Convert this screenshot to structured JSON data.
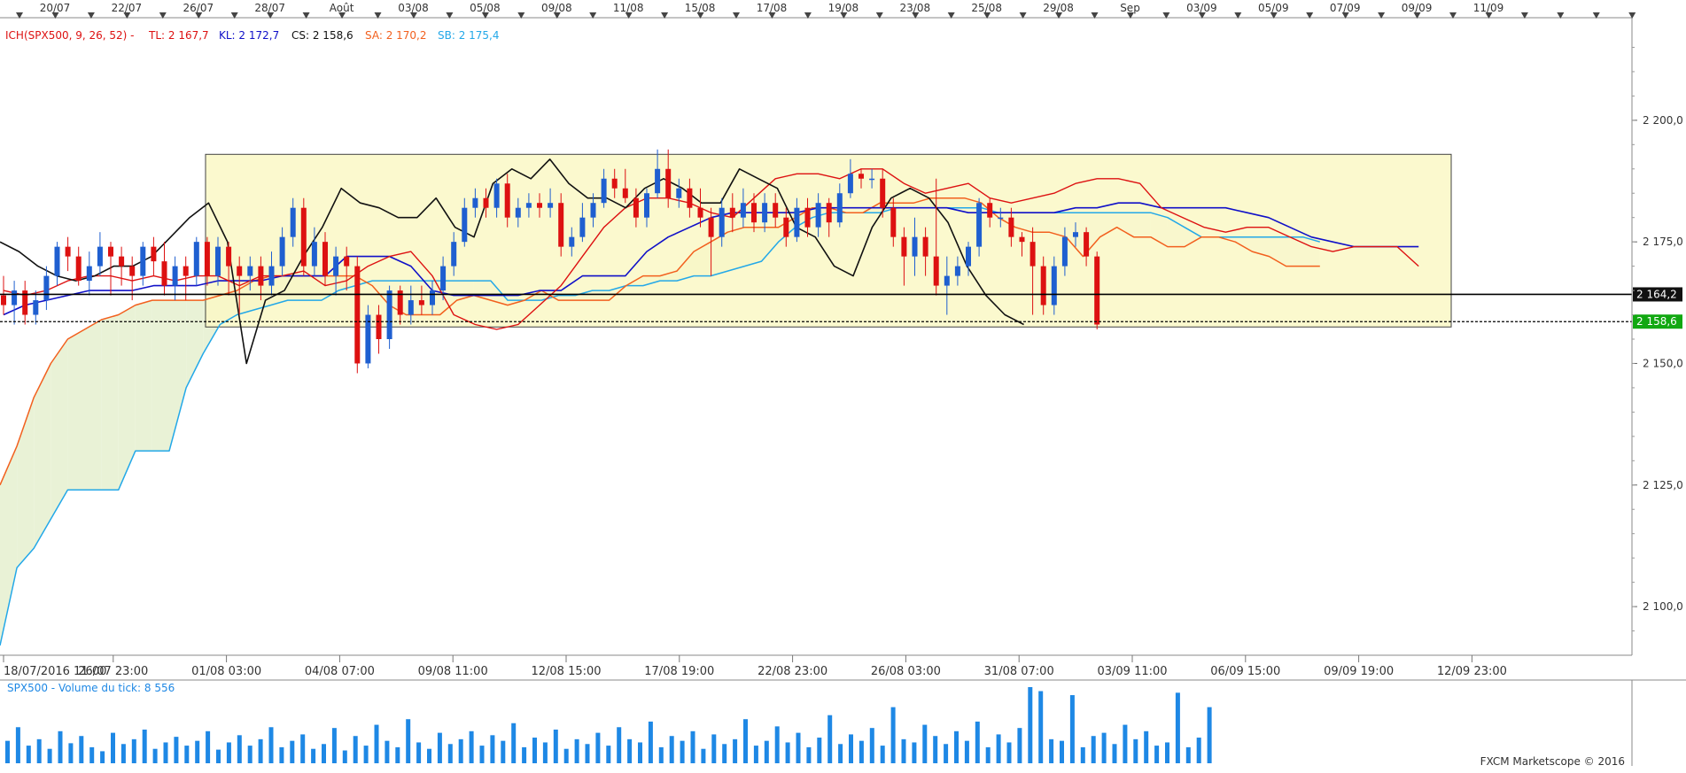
{
  "chart_data": {
    "type": "candlestick",
    "title": "",
    "top_dates": [
      "20/07",
      "22/07",
      "26/07",
      "28/07",
      "Août",
      "03/08",
      "05/08",
      "09/08",
      "11/08",
      "15/08",
      "17/08",
      "19/08",
      "23/08",
      "25/08",
      "29/08",
      "Sep",
      "03/09",
      "05/09",
      "07/09",
      "09/09",
      "11/09"
    ],
    "bottom_dates": [
      "18/07/2016 11:00",
      "26/07 23:00",
      "01/08 03:00",
      "04/08 07:00",
      "09/08 11:00",
      "12/08 15:00",
      "17/08 19:00",
      "22/08 23:00",
      "26/08 03:00",
      "31/08 07:00",
      "03/09 11:00",
      "06/09 15:00",
      "09/09 19:00",
      "12/09 23:00"
    ],
    "ylim": [
      2090,
      2220
    ],
    "y_ticks": [
      "2 200,0",
      "2 175,0",
      "2 150,0",
      "2 125,0",
      "2 100,0"
    ],
    "y_tick_values": [
      2200,
      2175,
      2150,
      2125,
      2100
    ],
    "legend": {
      "prefix": "ICH(SPX500, 9, 26, 52) -",
      "tl": "TL: 2 167,7",
      "kl": "KL: 2 172,7",
      "cs": "CS: 2 158,6",
      "sa": "SA: 2 170,2",
      "sb": "SB: 2 175,4"
    },
    "levels": [
      {
        "value": 2164.2,
        "label": "2 164,2",
        "style": "solid"
      },
      {
        "value": 2158.6,
        "label": "2 158,6",
        "style": "dotted"
      }
    ],
    "range_box": {
      "low": 2157.5,
      "high": 2193
    },
    "series": {
      "tenkan": [
        2165,
        2164,
        2165,
        2167,
        2168,
        2168,
        2167,
        2168,
        2167,
        2168,
        2168,
        2166,
        2168,
        2168,
        2169,
        2166,
        2167,
        2170,
        2172,
        2173,
        2168,
        2160,
        2158,
        2157,
        2158,
        2162,
        2166,
        2172,
        2178,
        2182,
        2184,
        2184,
        2183,
        2181,
        2180,
        2184,
        2188,
        2189,
        2189,
        2188,
        2190,
        2190,
        2187,
        2185,
        2186,
        2187,
        2184,
        2183,
        2184,
        2185,
        2187,
        2188,
        2188,
        2187,
        2182,
        2180,
        2178,
        2177,
        2178,
        2178,
        2176,
        2174,
        2173,
        2174,
        2174,
        2174,
        2170
      ],
      "kijun": [
        2160,
        2162,
        2163,
        2164,
        2165,
        2165,
        2165,
        2166,
        2166,
        2166,
        2167,
        2167,
        2167,
        2168,
        2168,
        2168,
        2172,
        2172,
        2172,
        2170,
        2165,
        2164,
        2164,
        2164,
        2164,
        2165,
        2165,
        2168,
        2168,
        2168,
        2173,
        2176,
        2178,
        2180,
        2181,
        2181,
        2181,
        2181,
        2182,
        2182,
        2182,
        2182,
        2182,
        2182,
        2182,
        2181,
        2181,
        2181,
        2181,
        2181,
        2182,
        2182,
        2183,
        2183,
        2182,
        2182,
        2182,
        2182,
        2181,
        2180,
        2178,
        2176,
        2175,
        2174,
        2174,
        2174,
        2174
      ],
      "chikou": [
        2175,
        2173,
        2170,
        2168,
        2167,
        2168,
        2170,
        2170,
        2172,
        2176,
        2180,
        2183,
        2175,
        2150,
        2163,
        2165,
        2172,
        2178,
        2186,
        2183,
        2182,
        2180,
        2180,
        2184,
        2178,
        2176,
        2187,
        2190,
        2188,
        2192,
        2187,
        2184,
        2184,
        2182,
        2186,
        2188,
        2186,
        2183,
        2183,
        2190,
        2188,
        2186,
        2178,
        2176,
        2170,
        2168,
        2178,
        2184,
        2186,
        2184,
        2179,
        2170,
        2164,
        2160,
        2158
      ],
      "senkou_a": [
        2125,
        2133,
        2143,
        2150,
        2155,
        2157,
        2159,
        2160,
        2162,
        2163,
        2163,
        2163,
        2163,
        2164,
        2165,
        2167,
        2168,
        2168,
        2168,
        2168,
        2168,
        2168,
        2166,
        2162,
        2160,
        2160,
        2160,
        2163,
        2164,
        2163,
        2162,
        2163,
        2165,
        2163,
        2163,
        2163,
        2163,
        2166,
        2168,
        2168,
        2169,
        2173,
        2175,
        2177,
        2178,
        2178,
        2178,
        2180,
        2182,
        2182,
        2181,
        2181,
        2183,
        2183,
        2183,
        2184,
        2184,
        2184,
        2183,
        2180,
        2178,
        2177,
        2177,
        2176,
        2172,
        2176,
        2178,
        2176,
        2176,
        2174,
        2174,
        2176,
        2176,
        2175,
        2173,
        2172,
        2170,
        2170,
        2170
      ],
      "senkou_b": [
        2092,
        2108,
        2112,
        2118,
        2124,
        2124,
        2124,
        2124,
        2132,
        2132,
        2132,
        2145,
        2152,
        2158,
        2160,
        2161,
        2162,
        2163,
        2163,
        2163,
        2165,
        2166,
        2167,
        2167,
        2167,
        2167,
        2167,
        2167,
        2167,
        2167,
        2163,
        2163,
        2163,
        2164,
        2164,
        2165,
        2165,
        2166,
        2166,
        2167,
        2167,
        2168,
        2168,
        2169,
        2170,
        2171,
        2175,
        2178,
        2180,
        2181,
        2181,
        2181,
        2181,
        2182,
        2182,
        2182,
        2182,
        2182,
        2182,
        2181,
        2181,
        2181,
        2181,
        2181,
        2181,
        2181,
        2181,
        2181,
        2181,
        2180,
        2178,
        2176,
        2176,
        2176,
        2176,
        2176,
        2176,
        2176,
        2175
      ]
    },
    "candles": [
      [
        2164,
        2162,
        2168,
        2160
      ],
      [
        2162,
        2165,
        2167,
        2158
      ],
      [
        2165,
        2160,
        2167,
        2158
      ],
      [
        2160,
        2163,
        2165,
        2158
      ],
      [
        2163,
        2168,
        2170,
        2161
      ],
      [
        2168,
        2174,
        2175,
        2166
      ],
      [
        2174,
        2172,
        2176,
        2169
      ],
      [
        2172,
        2167,
        2174,
        2166
      ],
      [
        2167,
        2170,
        2173,
        2164
      ],
      [
        2170,
        2174,
        2177,
        2168
      ],
      [
        2174,
        2172,
        2175,
        2164
      ],
      [
        2172,
        2170,
        2174,
        2166
      ],
      [
        2170,
        2168,
        2172,
        2163
      ],
      [
        2168,
        2174,
        2175,
        2166
      ],
      [
        2174,
        2171,
        2176,
        2168
      ],
      [
        2171,
        2166,
        2175,
        2164
      ],
      [
        2166,
        2170,
        2172,
        2163
      ],
      [
        2170,
        2168,
        2172,
        2163
      ],
      [
        2168,
        2175,
        2176,
        2166
      ],
      [
        2175,
        2168,
        2176,
        2166
      ],
      [
        2168,
        2174,
        2176,
        2166
      ],
      [
        2174,
        2170,
        2175,
        2164
      ],
      [
        2170,
        2168,
        2172,
        2160
      ],
      [
        2168,
        2170,
        2172,
        2165
      ],
      [
        2170,
        2166,
        2172,
        2163
      ],
      [
        2166,
        2170,
        2173,
        2164
      ],
      [
        2170,
        2176,
        2178,
        2168
      ],
      [
        2176,
        2182,
        2184,
        2174
      ],
      [
        2182,
        2170,
        2184,
        2168
      ],
      [
        2170,
        2175,
        2178,
        2168
      ],
      [
        2175,
        2168,
        2177,
        2166
      ],
      [
        2168,
        2172,
        2174,
        2164
      ],
      [
        2172,
        2170,
        2174,
        2165
      ],
      [
        2170,
        2150,
        2172,
        2148
      ],
      [
        2150,
        2160,
        2162,
        2149
      ],
      [
        2160,
        2155,
        2162,
        2152
      ],
      [
        2155,
        2165,
        2166,
        2153
      ],
      [
        2165,
        2160,
        2166,
        2158
      ],
      [
        2160,
        2163,
        2166,
        2158
      ],
      [
        2163,
        2162,
        2166,
        2160
      ],
      [
        2162,
        2165,
        2167,
        2160
      ],
      [
        2165,
        2170,
        2172,
        2163
      ],
      [
        2170,
        2175,
        2177,
        2168
      ],
      [
        2175,
        2182,
        2184,
        2174
      ],
      [
        2182,
        2184,
        2186,
        2180
      ],
      [
        2184,
        2182,
        2186,
        2180
      ],
      [
        2182,
        2187,
        2188,
        2180
      ],
      [
        2187,
        2180,
        2189,
        2178
      ],
      [
        2180,
        2182,
        2184,
        2178
      ],
      [
        2182,
        2183,
        2185,
        2180
      ],
      [
        2183,
        2182,
        2185,
        2180
      ],
      [
        2182,
        2183,
        2186,
        2180
      ],
      [
        2183,
        2174,
        2185,
        2172
      ],
      [
        2174,
        2176,
        2178,
        2172
      ],
      [
        2176,
        2180,
        2183,
        2175
      ],
      [
        2180,
        2183,
        2185,
        2178
      ],
      [
        2183,
        2188,
        2190,
        2182
      ],
      [
        2188,
        2186,
        2190,
        2184
      ],
      [
        2186,
        2184,
        2190,
        2183
      ],
      [
        2184,
        2180,
        2186,
        2178
      ],
      [
        2180,
        2185,
        2186,
        2178
      ],
      [
        2185,
        2190,
        2194,
        2184
      ],
      [
        2190,
        2184,
        2194,
        2182
      ],
      [
        2184,
        2186,
        2188,
        2182
      ],
      [
        2186,
        2182,
        2188,
        2180
      ],
      [
        2182,
        2180,
        2186,
        2178
      ],
      [
        2180,
        2176,
        2182,
        2168
      ],
      [
        2176,
        2182,
        2184,
        2174
      ],
      [
        2182,
        2180,
        2185,
        2177
      ],
      [
        2180,
        2183,
        2186,
        2178
      ],
      [
        2183,
        2179,
        2185,
        2177
      ],
      [
        2179,
        2183,
        2185,
        2177
      ],
      [
        2183,
        2180,
        2185,
        2178
      ],
      [
        2180,
        2176,
        2182,
        2174
      ],
      [
        2176,
        2182,
        2184,
        2175
      ],
      [
        2182,
        2178,
        2184,
        2176
      ],
      [
        2178,
        2183,
        2185,
        2176
      ],
      [
        2183,
        2179,
        2184,
        2176
      ],
      [
        2179,
        2185,
        2187,
        2178
      ],
      [
        2185,
        2189,
        2192,
        2184
      ],
      [
        2189,
        2188,
        2190,
        2186
      ],
      [
        2188,
        2188,
        2190,
        2186
      ],
      [
        2188,
        2182,
        2190,
        2180
      ],
      [
        2182,
        2176,
        2184,
        2174
      ],
      [
        2176,
        2172,
        2178,
        2166
      ],
      [
        2172,
        2176,
        2180,
        2168
      ],
      [
        2176,
        2172,
        2178,
        2168
      ],
      [
        2172,
        2166,
        2188,
        2164
      ],
      [
        2166,
        2168,
        2172,
        2160
      ],
      [
        2168,
        2170,
        2172,
        2166
      ],
      [
        2170,
        2174,
        2175,
        2168
      ],
      [
        2174,
        2183,
        2184,
        2172
      ],
      [
        2183,
        2180,
        2184,
        2178
      ],
      [
        2180,
        2180,
        2182,
        2178
      ],
      [
        2180,
        2176,
        2182,
        2174
      ],
      [
        2176,
        2175,
        2177,
        2172
      ],
      [
        2175,
        2170,
        2178,
        2160
      ],
      [
        2170,
        2162,
        2172,
        2160
      ],
      [
        2162,
        2170,
        2172,
        2160
      ],
      [
        2170,
        2176,
        2178,
        2168
      ],
      [
        2176,
        2177,
        2179,
        2174
      ],
      [
        2177,
        2172,
        2178,
        2170
      ],
      [
        2172,
        2158,
        2173,
        2157
      ]
    ],
    "volume_panel": {
      "title": "SPX500 - Volume du tick: 8 556",
      "values": [
        28,
        45,
        22,
        30,
        18,
        40,
        25,
        34,
        20,
        15,
        38,
        24,
        30,
        42,
        18,
        26,
        33,
        22,
        28,
        40,
        17,
        26,
        35,
        22,
        30,
        45,
        20,
        28,
        36,
        18,
        24,
        44,
        16,
        34,
        22,
        48,
        28,
        20,
        55,
        26,
        18,
        38,
        24,
        30,
        40,
        22,
        35,
        28,
        50,
        20,
        32,
        26,
        42,
        18,
        30,
        24,
        38,
        22,
        45,
        30,
        26,
        52,
        20,
        34,
        28,
        40,
        18,
        36,
        24,
        30,
        55,
        22,
        28,
        46,
        26,
        38,
        20,
        32,
        60,
        24,
        36,
        28,
        44,
        22,
        70,
        30,
        26,
        48,
        34,
        24,
        40,
        28,
        52,
        20,
        36,
        26,
        44,
        95,
        90,
        30,
        28,
        85,
        20,
        34,
        38,
        24,
        48,
        30,
        40,
        22,
        26,
        88,
        20,
        32,
        70
      ]
    },
    "watermark": "FXCM Marketscope © 2016",
    "colors": {
      "up": "#1f5fd0",
      "down": "#dd1111",
      "tenkan": "#dd1111",
      "kijun": "#1010c8",
      "chikou": "#111111",
      "senkou_a": "#f2601e",
      "senkou_b": "#23a8e8",
      "cloud_bull": "#e9f2d6",
      "cloud_bear": "#eef6fb",
      "box_fill": "#fbf8c6",
      "volume": "#1e88e5",
      "cs_label_bg": "#11a811"
    }
  }
}
